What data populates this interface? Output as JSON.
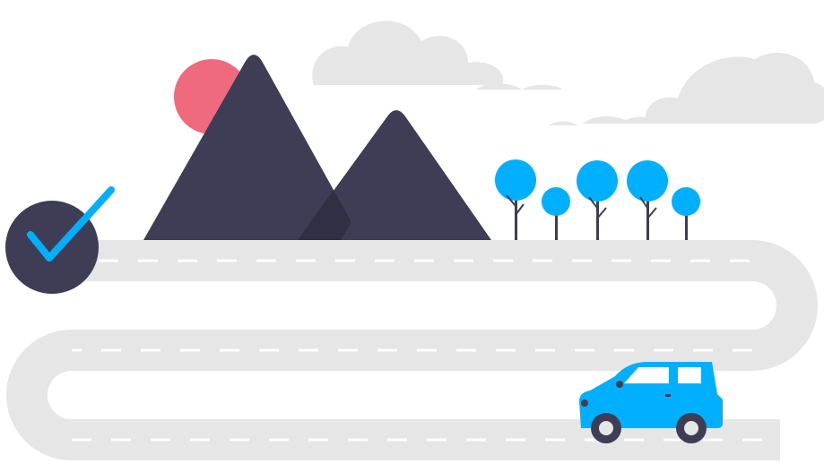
{
  "scene": {
    "name": "road-trip-illustration",
    "elements": [
      "clouds",
      "sun",
      "mountains",
      "trees",
      "winding-road",
      "car",
      "checkmark-badge"
    ]
  },
  "colors": {
    "background": "#ffffff",
    "cloud": "#e6e6e6",
    "sun": "#f06a7e",
    "mountain": "#3f3d56",
    "mountain_shadow": "#2f2e41",
    "tree": "#00b0ff",
    "trunk": "#3f3d56",
    "road": "#e6e6e6",
    "lane_marking": "#ffffff",
    "car_body": "#00b0ff",
    "car_window": "#ffffff",
    "wheel": "#3f3d56",
    "hubcap": "#e6e6e6",
    "badge": "#3f3d56",
    "check": "#00b0ff"
  },
  "icons": {
    "checkmark": "check-icon",
    "car": "car-icon"
  }
}
